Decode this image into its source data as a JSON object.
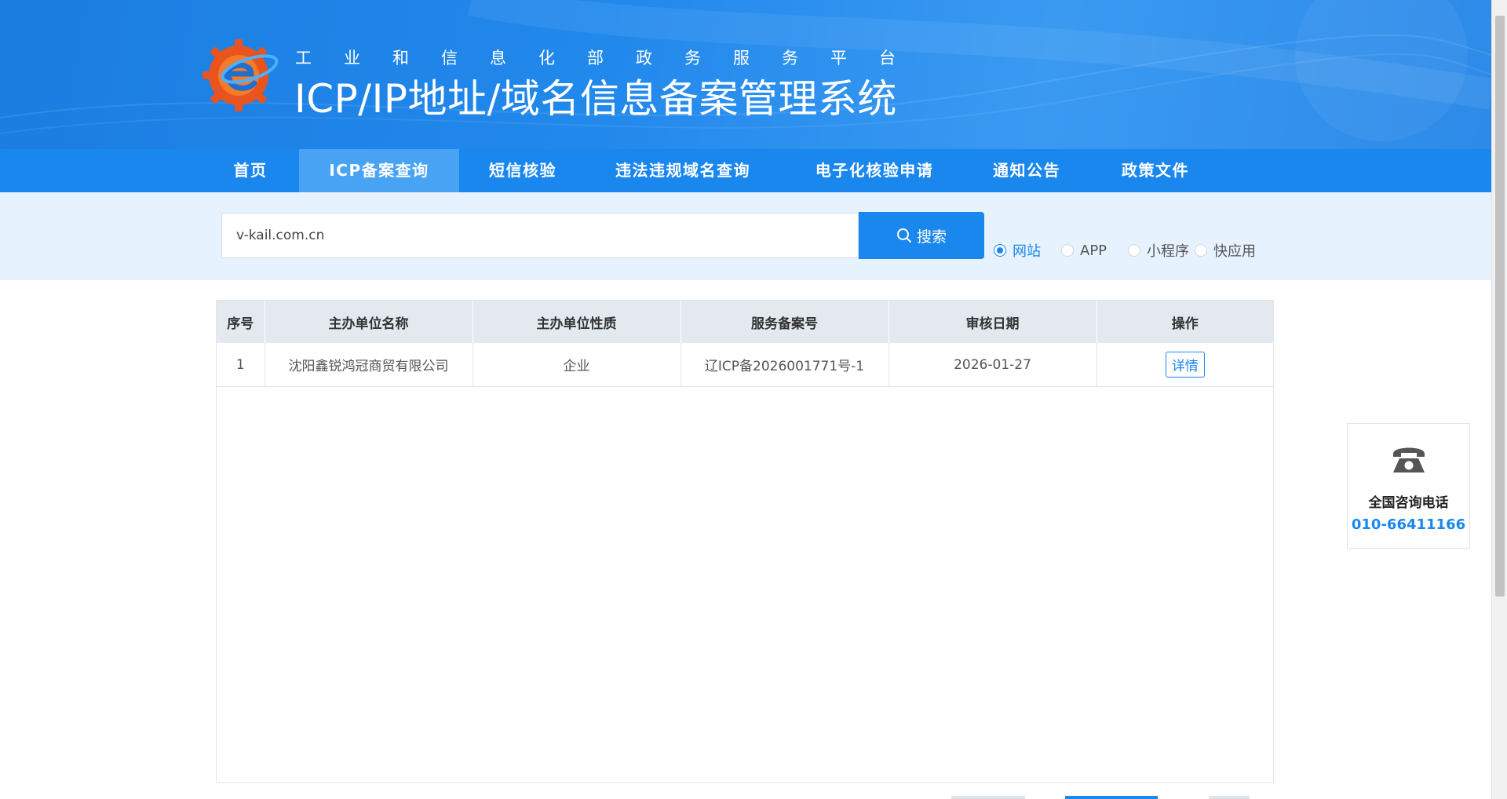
{
  "header": {
    "subtitle": "工业和信息化部政务服务平台",
    "title": "ICP/IP地址/域名信息备案管理系统"
  },
  "nav": {
    "items": [
      {
        "label": "首页"
      },
      {
        "label": "ICP备案查询",
        "active": true
      },
      {
        "label": "短信核验"
      },
      {
        "label": "违法违规域名查询"
      },
      {
        "label": "电子化核验申请"
      },
      {
        "label": "通知公告"
      },
      {
        "label": "政策文件"
      }
    ]
  },
  "search": {
    "value": "v-kail.com.cn",
    "button_label": "搜索",
    "options": [
      {
        "label": "网站",
        "checked": true
      },
      {
        "label": "APP",
        "checked": false
      },
      {
        "label": "小程序",
        "checked": false
      },
      {
        "label": "快应用",
        "checked": false
      }
    ]
  },
  "table": {
    "headers": [
      "序号",
      "主办单位名称",
      "主办单位性质",
      "服务备案号",
      "审核日期",
      "操作"
    ],
    "rows": [
      {
        "index": "1",
        "org_name": "沈阳鑫锐鸿冠商贸有限公司",
        "org_type": "企业",
        "record_no": "辽ICP备2026001771号-1",
        "date": "2026-01-27",
        "action": "详情"
      }
    ]
  },
  "contact": {
    "label": "全国咨询电话",
    "number": "010-66411166"
  },
  "colors": {
    "primary": "#1a87ef",
    "nav_active": "#49a3f4",
    "search_band": "#e6f2fd",
    "table_header": "#e4e9f0"
  }
}
